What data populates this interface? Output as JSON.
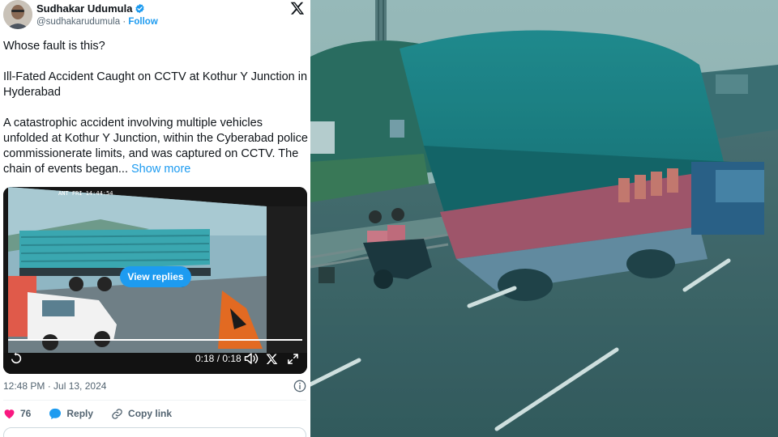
{
  "tweet": {
    "author": {
      "name": "Sudhakar Udumula",
      "handle": "@sudhakarudumula",
      "separator": "·",
      "follow_label": "Follow"
    },
    "text": {
      "question": "Whose fault is this?",
      "headline": "Ill-Fated Accident Caught on CCTV at Kothur Y Junction in Hyderabad",
      "body": "A catastrophic accident involving multiple vehicles unfolded at Kothur Y Junction, within the Cyberabad police commissionerate limits, and was captured on CCTV. The chain of events began...",
      "show_more": "Show more"
    },
    "video": {
      "overlay_button": "View replies",
      "elapsed": "0:18",
      "duration": "0:18",
      "time_separator": " / ",
      "progress": 1.0,
      "cctv_stamp": "ANT FRI 14:44:54"
    },
    "timestamp": "12:48 PM · Jul 13, 2024",
    "actions": {
      "likes": "76",
      "reply_label": "Reply",
      "copy_label": "Copy link"
    }
  },
  "colors": {
    "accent": "#1d9bf0",
    "like": "#f91880",
    "text_primary": "#0f1419",
    "text_secondary": "#536471"
  },
  "icons": [
    "verified-badge-icon",
    "x-logo-icon",
    "replay-icon",
    "volume-icon",
    "x-share-icon",
    "fullscreen-icon",
    "info-icon",
    "heart-icon",
    "reply-bubble-icon",
    "link-icon"
  ]
}
